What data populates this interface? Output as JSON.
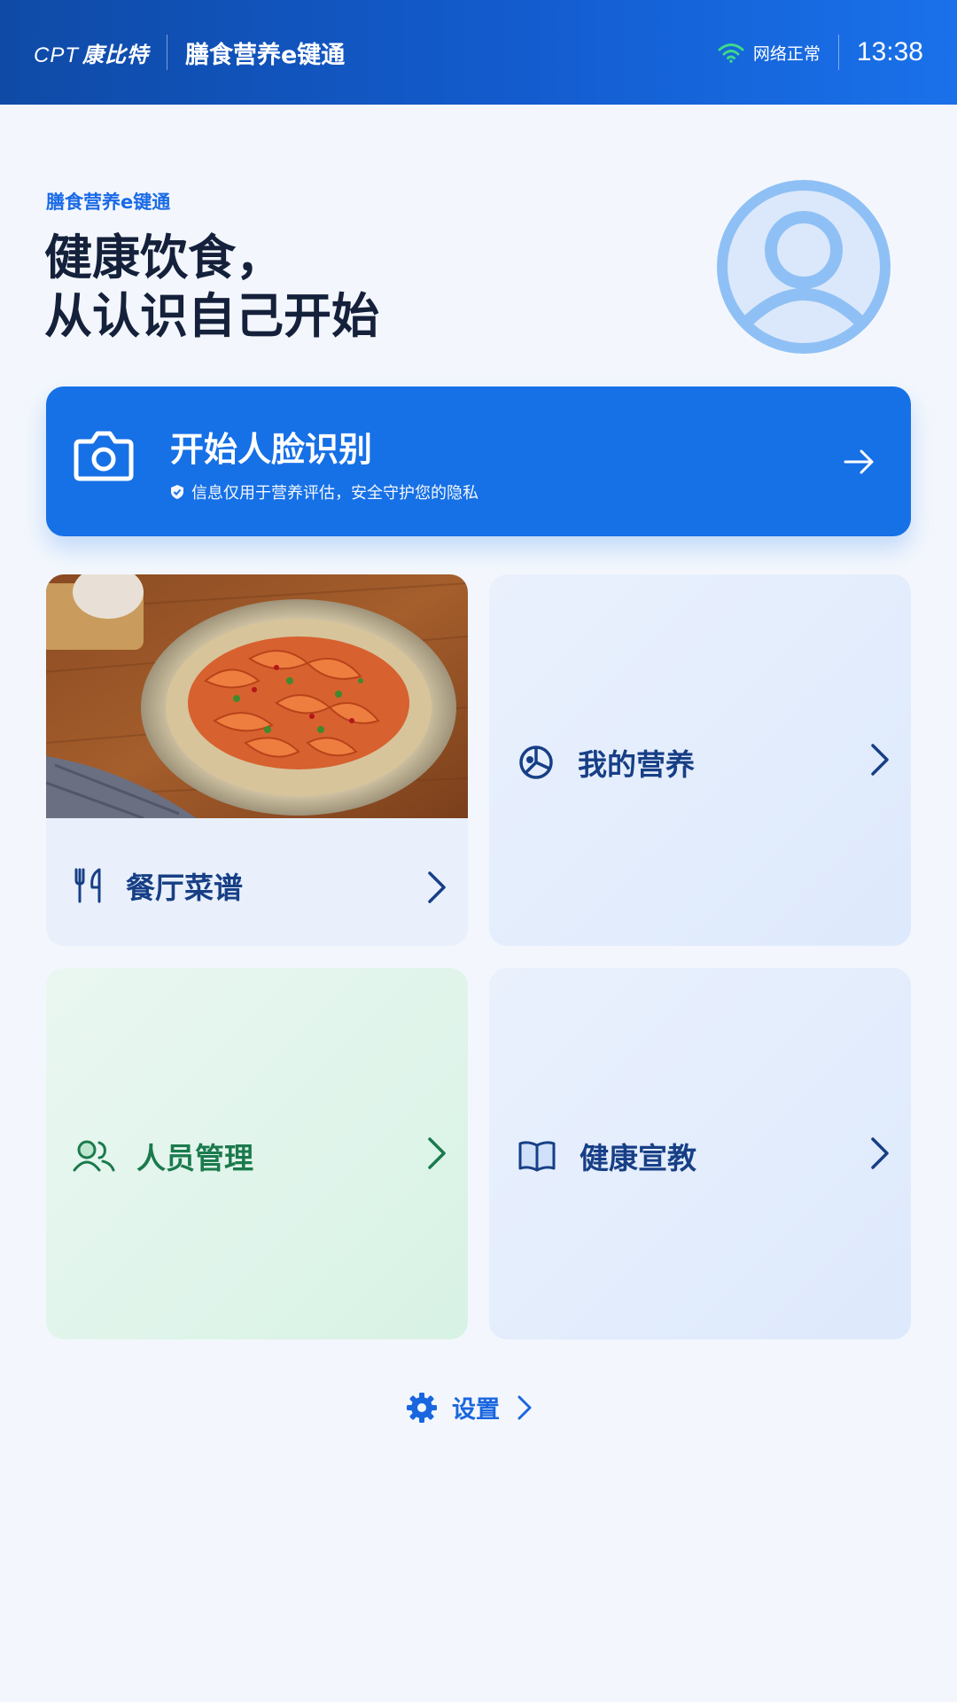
{
  "header": {
    "brand_latin": "CPT",
    "brand_cn": "康比特",
    "app_title": "膳食营养e键通",
    "network_status": "网络正常",
    "time": "13:38"
  },
  "hero": {
    "subtitle": "膳食营养e键通",
    "title_line1": "健康饮食，",
    "title_line2": "从认识自己开始"
  },
  "face_recognition": {
    "label": "开始人脸识别",
    "note": "信息仅用于营养评估，安全守护您的隐私"
  },
  "cards": {
    "menu": {
      "label": "餐厅菜谱",
      "icon": "utensils-icon"
    },
    "nutrition": {
      "label": "我的营养",
      "icon": "pie-chart-icon"
    },
    "staff": {
      "label": "人员管理",
      "icon": "users-icon"
    },
    "education": {
      "label": "健康宣教",
      "icon": "book-icon"
    }
  },
  "settings": {
    "label": "设置",
    "icon": "gear-icon"
  },
  "colors": {
    "primary": "#1670e6",
    "header_start": "#0f4aa6",
    "header_end": "#1a71ea",
    "card_blue": "#e9f0fc",
    "card_green": "#ddf3e8",
    "text_dark_blue": "#173f86",
    "text_green": "#1b7a4d",
    "network_green": "#3ed88a"
  }
}
